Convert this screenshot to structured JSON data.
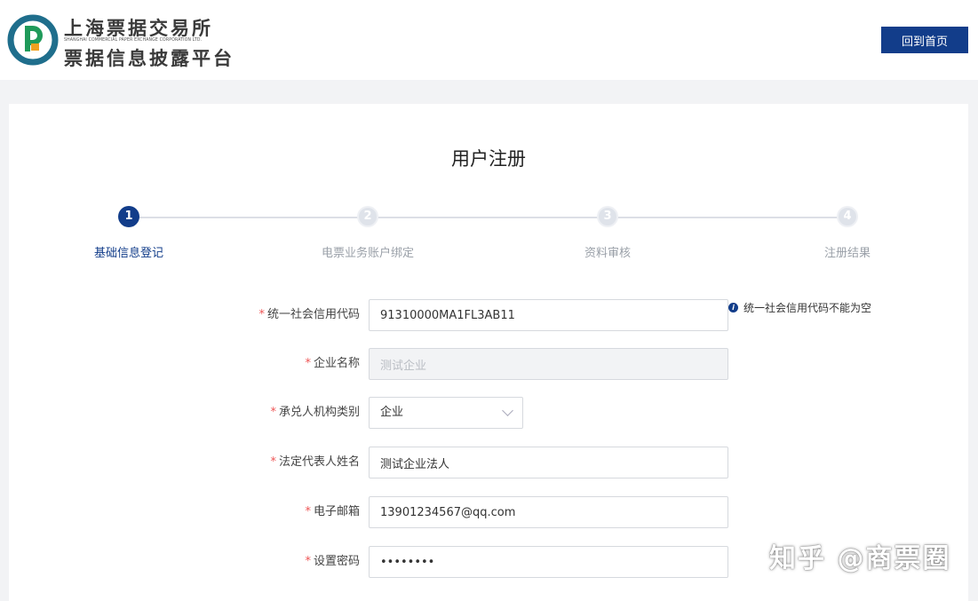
{
  "header": {
    "logo_cn_top": "上海票据交易所",
    "logo_en": "SHANGHAI COMMERCIAL PAPER EXCHANGE CORPORATION LTD.",
    "logo_cn_bottom": "票据信息披露平台",
    "home_button": "回到首页",
    "brand_color": "#123d8a"
  },
  "page": {
    "title": "用户注册"
  },
  "steps": [
    {
      "number": "1",
      "label": "基础信息登记",
      "state": "active"
    },
    {
      "number": "2",
      "label": "电票业务账户绑定",
      "state": "todo"
    },
    {
      "number": "3",
      "label": "资料审核",
      "state": "todo"
    },
    {
      "number": "4",
      "label": "注册结果",
      "state": "todo"
    }
  ],
  "form": {
    "credit_code": {
      "label": "统一社会信用代码",
      "value": "91310000MA1FL3AB11",
      "hint": "统一社会信用代码不能为空"
    },
    "company_name": {
      "label": "企业名称",
      "value": "测试企业"
    },
    "acceptor_type": {
      "label": "承兑人机构类别",
      "value": "企业"
    },
    "legal_rep": {
      "label": "法定代表人姓名",
      "value": "测试企业法人"
    },
    "email": {
      "label": "电子邮箱",
      "value": "13901234567@qq.com"
    },
    "password": {
      "label": "设置密码",
      "value": "••••••••"
    }
  },
  "watermark": "知乎 @商票圈"
}
